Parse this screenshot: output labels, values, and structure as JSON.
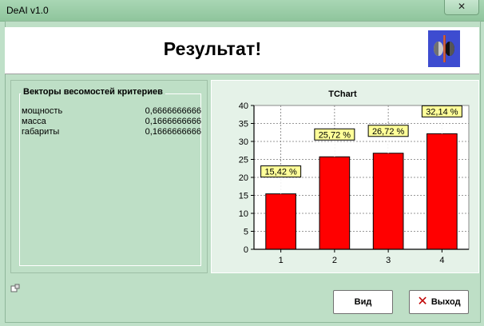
{
  "window": {
    "title": "DeAI v1.0",
    "close_symbol": "✕"
  },
  "header": {
    "title": "Результат!"
  },
  "weights": {
    "title": "Векторы весомостей критериев",
    "rows": [
      {
        "label": "мощность",
        "value": "0,6666666666"
      },
      {
        "label": "масса",
        "value": "0,1666666666"
      },
      {
        "label": "габариты",
        "value": "0,1666666666"
      }
    ]
  },
  "buttons": {
    "view": "Вид",
    "exit": "Выход"
  },
  "colors": {
    "bar": "#ff0000",
    "label_bg": "#ffff99",
    "logo_bg": "#3d4cd0"
  },
  "chart_data": {
    "type": "bar",
    "title": "TChart",
    "categories": [
      "1",
      "2",
      "3",
      "4"
    ],
    "values": [
      15.42,
      25.72,
      26.72,
      32.14
    ],
    "data_labels": [
      "15,42 %",
      "25,72 %",
      "26,72 %",
      "32,14 %"
    ],
    "ylim": [
      0,
      40
    ],
    "yticks": [
      "0",
      "5",
      "10",
      "15",
      "20",
      "25",
      "30",
      "35",
      "40"
    ],
    "grid": true,
    "xlabel": "",
    "ylabel": ""
  }
}
